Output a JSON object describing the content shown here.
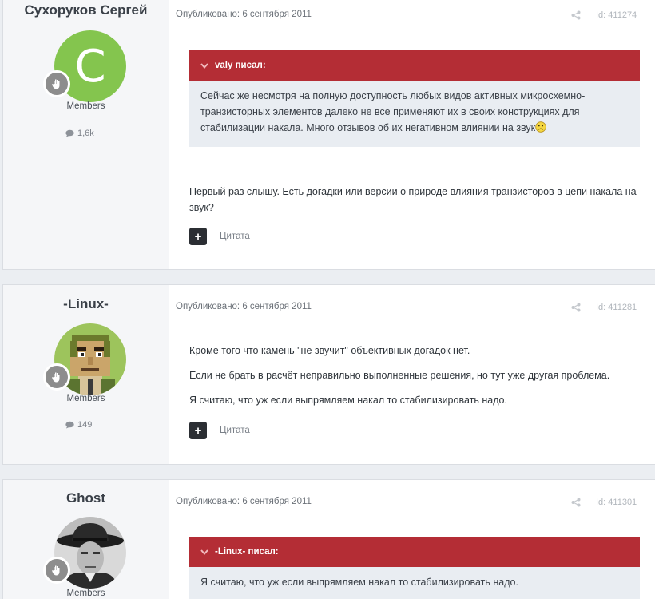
{
  "posts": [
    {
      "author": "Сухоруков Сергей",
      "avatar_letter": "C",
      "avatar_color": "#84c54e",
      "group": "Members",
      "post_count": "1,6k",
      "meta": "Опубликовано: 6 сентября 2011",
      "id_label": "Id: 411274",
      "quote": {
        "head": "valy писал:",
        "text": "Сейчас же несмотря на полную доступность любых видов активных микросхемно-транзисторных элементов далеко не все применяют их в своих конструкциях для стабилизации накала. Много отзывов об их негативном влиянии на звук"
      },
      "paragraphs": [
        "Первый раз слышу. Есть догадки или версии о природе влияния транзисторов в цепи накала на звук?"
      ],
      "quote_button": "Цитата"
    },
    {
      "author": "-Linux-",
      "group": "Members",
      "post_count": "149",
      "meta": "Опубликовано: 6 сентября 2011",
      "id_label": "Id: 411281",
      "paragraphs": [
        "Кроме того что камень \"не звучит\" объективных догадок нет.",
        "Если не брать в расчёт неправильно выполненные решения, но тут уже другая проблема.",
        "Я считаю, что уж если выпрямляем накал то стабилизировать надо."
      ],
      "quote_button": "Цитата"
    },
    {
      "author": "Ghost",
      "group": "Members",
      "meta": "Опубликовано: 6 сентября 2011",
      "id_label": "Id: 411301",
      "quote": {
        "head": "-Linux- писал:",
        "text": "Я считаю, что уж если выпрямляем накал то стабилизировать надо."
      }
    }
  ],
  "colors": {
    "quote_header": "#b42d35",
    "quote_body": "#e9edf2",
    "sidebar": "#f5f6f8"
  },
  "icons": {
    "share": "share-icon",
    "rank": "rank-hand-icon",
    "comment": "comment-icon",
    "plus": "plus-icon",
    "chevron": "chevron-down-icon",
    "sad": "sad-emoji-icon"
  }
}
